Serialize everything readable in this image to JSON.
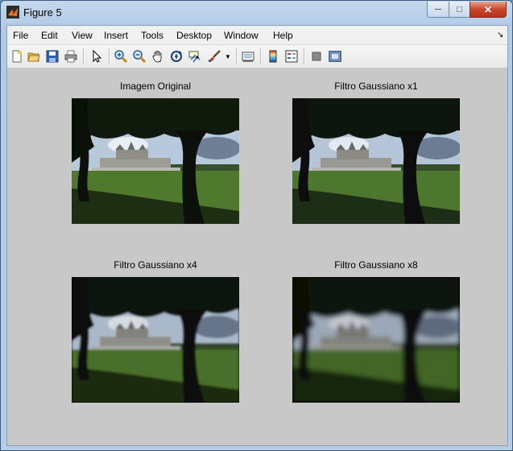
{
  "window": {
    "title": "Figure 5"
  },
  "menu": [
    "File",
    "Edit",
    "View",
    "Insert",
    "Tools",
    "Desktop",
    "Window",
    "Help"
  ],
  "toolbar_icons": [
    "new-figure-icon",
    "open-file-icon",
    "save-icon",
    "print-icon",
    "pointer-icon",
    "zoom-in-icon",
    "zoom-out-icon",
    "pan-hand-icon",
    "rotate-3d-icon",
    "data-cursor-icon",
    "brush-icon",
    "brush-dropdown-icon",
    "link-plot-icon",
    "colorbar-icon",
    "legend-icon",
    "hide-plot-tools-icon",
    "show-plot-tools-icon"
  ],
  "panels": [
    {
      "title": "Imagem Original",
      "blur": 0
    },
    {
      "title": "Filtro Gaussiano x1",
      "blur": 1
    },
    {
      "title": "Filtro Gaussiano x4",
      "blur": 4
    },
    {
      "title": "Filtro Gaussiano x8",
      "blur": 8
    }
  ],
  "colors": {
    "figure_bg": "#c8c8c8",
    "grass": "#4f7a2e",
    "sky": "#b9c9dc"
  }
}
